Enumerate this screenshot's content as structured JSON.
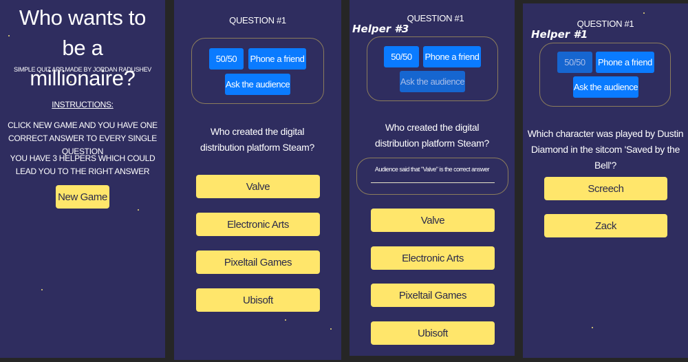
{
  "start": {
    "title": "Who wants to be a millionaire?",
    "subtitle": "SIMPLE QUIZ APP MADE BY JORDAN RADUSHEV",
    "instructions_heading": "INSTRUCTIONS:",
    "instruction_1": "CLICK NEW GAME AND YOU HAVE ONE CORRECT ANSWER TO EVERY SINGLE QUESTION",
    "instruction_2": "YOU HAVE 3 HELPERS WHICH COULD LEAD YOU TO THE RIGHT ANSWER",
    "new_game": "New Game"
  },
  "helpers": {
    "fifty": "50/50",
    "phone": "Phone a friend",
    "audience": "Ask the audience"
  },
  "screen2": {
    "question_label": "QUESTION #1",
    "question": "Who created the digital distribution platform Steam?",
    "answers": [
      "Valve",
      "Electronic Arts",
      "Pixeltail Games",
      "Ubisoft"
    ]
  },
  "screen3": {
    "helper_label": "Helper #3",
    "question_label": "QUESTION #1",
    "question": "Who created the digital distribution platform Steam?",
    "audience_result": "Audience said that \"Valve\" is the correct answer",
    "answers": [
      "Valve",
      "Electronic Arts",
      "Pixeltail Games",
      "Ubisoft"
    ]
  },
  "screen4": {
    "helper_label": "Helper #1",
    "question_label": "QUESTION #1",
    "question": "Which character was played by Dustin Diamond in the sitcom 'Saved by the Bell'?",
    "answers": [
      "Screech",
      "Zack"
    ]
  }
}
